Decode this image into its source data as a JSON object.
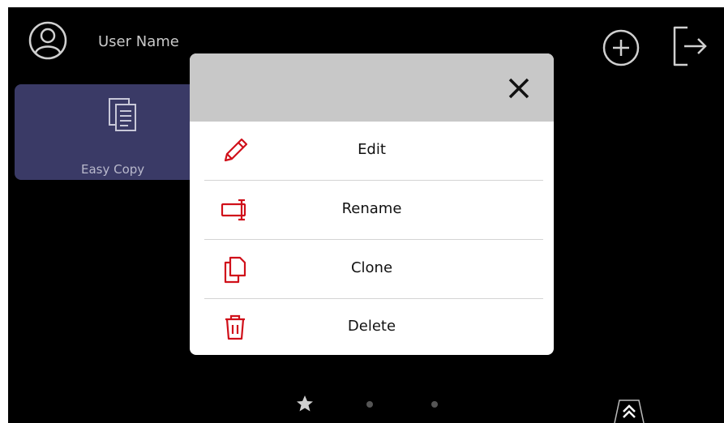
{
  "header": {
    "user_name": "User Name"
  },
  "tiles": [
    {
      "label": "Easy Copy",
      "icon": "copy-document-icon"
    }
  ],
  "dialog": {
    "close_icon": "close-icon",
    "items": [
      {
        "label": "Edit",
        "icon": "pencil-icon"
      },
      {
        "label": "Rename",
        "icon": "rename-icon"
      },
      {
        "label": "Clone",
        "icon": "clone-icon"
      },
      {
        "label": "Delete",
        "icon": "trash-icon"
      }
    ]
  },
  "colors": {
    "accent": "#d0101a",
    "tile_bg": "#3a3a66",
    "screen_bg": "#000000",
    "dialog_header": "#c8c8c8"
  }
}
